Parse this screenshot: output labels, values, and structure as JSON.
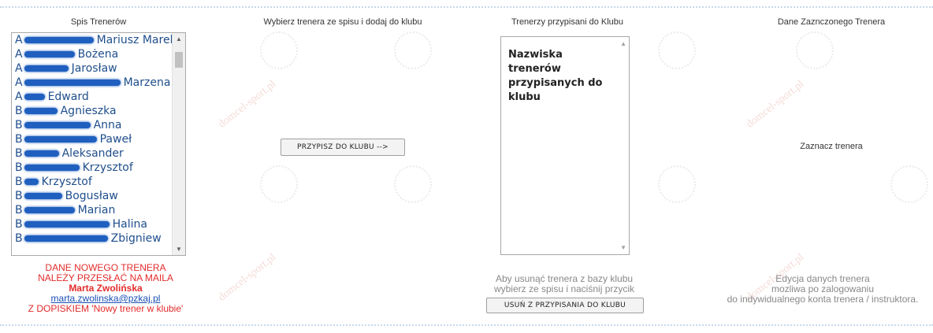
{
  "columns": {
    "list_title": "Spis Trenerów",
    "add_title": "Wybierz trenera ze spisu i dodaj do klubu",
    "assigned_title": "Trenerzy przypisani do Klubu",
    "details_title": "Dane Zaznczonego Trenera"
  },
  "trainers": [
    {
      "suffix": "Mariusz Marek"
    },
    {
      "suffix": "Bożena"
    },
    {
      "suffix": "Jarosław"
    },
    {
      "suffix": "Marzena"
    },
    {
      "suffix": "Edward"
    },
    {
      "suffix": "Agnieszka"
    },
    {
      "suffix": "Anna"
    },
    {
      "suffix": "Paweł"
    },
    {
      "suffix": "Aleksander"
    },
    {
      "suffix": "Krzysztof"
    },
    {
      "suffix": "Krzysztof"
    },
    {
      "suffix": "Bogusław"
    },
    {
      "suffix": "Marian"
    },
    {
      "suffix": "Halina"
    },
    {
      "suffix": "Zbigniew"
    }
  ],
  "buttons": {
    "assign": "PRZYPISZ DO KLUBU -->",
    "remove": "USUŃ Z PRZYPISANIA DO KLUBU"
  },
  "assigned_box": {
    "placeholder": "Nazwiska trenerów przypisanych do klubu"
  },
  "details": {
    "prompt": "Zaznacz trenera",
    "note_line1": "Edycja danych trenera",
    "note_line2": "mozliwa po zalogowaniu",
    "note_line3": "do indywidualnego konta trenera / instruktora."
  },
  "remove_note": {
    "line1": "Aby usunąć trenera z bazy klubu",
    "line2": "wybierz ze spisu i naciśnij przycik"
  },
  "new_trainer_note": {
    "line1": "DANE NOWEGO TRENERA",
    "line2": "NALEŻY PRZESŁAĆ NA MAILA",
    "name": "Marta Zwolińska",
    "email": "marta.zwolinska@pzkaj.pl",
    "line3": "Z DOPISKIEM 'Nowy trener w klubie'"
  },
  "watermark": "domcel-sport.pl"
}
